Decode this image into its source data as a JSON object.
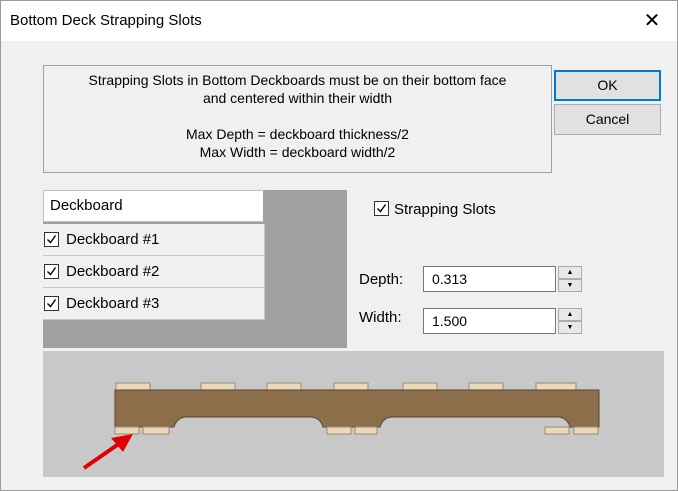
{
  "window": {
    "title": "Bottom Deck Strapping Slots"
  },
  "info": {
    "line1": "Strapping Slots in Bottom Deckboards must be on their bottom face",
    "line2": "and centered within their width",
    "line3": "Max Depth = deckboard thickness/2",
    "line4": "Max Width = deckboard width/2"
  },
  "buttons": {
    "ok": "OK",
    "cancel": "Cancel"
  },
  "grid": {
    "header": "Deckboard",
    "rows": [
      {
        "label": "Deckboard #1",
        "checked": true
      },
      {
        "label": "Deckboard #2",
        "checked": true
      },
      {
        "label": "Deckboard #3",
        "checked": true
      }
    ]
  },
  "strapping": {
    "label": "Strapping Slots",
    "checked": true
  },
  "depth": {
    "label": "Depth:",
    "value": "0.313"
  },
  "width": {
    "label": "Width:",
    "value": "1.500"
  },
  "icons": {
    "close": "close-icon",
    "check": "checkmark-icon",
    "arrow": "red-arrow-icon"
  },
  "colors": {
    "board": "#8c6f4a",
    "stringer_top": "#e8d8bc",
    "arrow": "#e00000",
    "preview_bg": "#c8c8c8"
  }
}
